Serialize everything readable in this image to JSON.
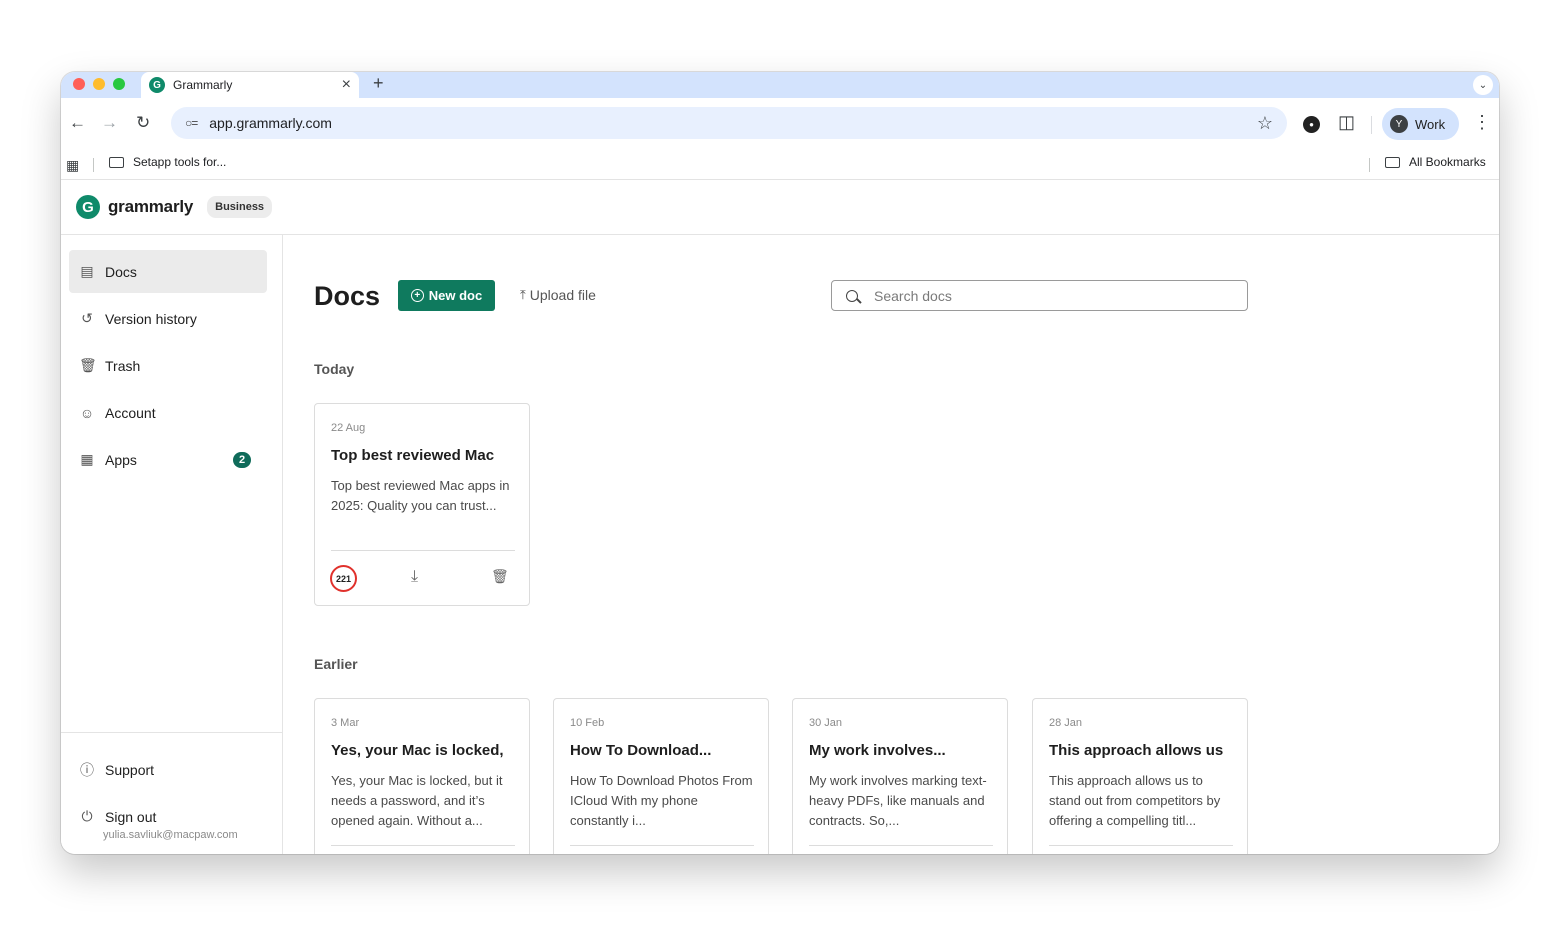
{
  "browser": {
    "tab_title": "Grammarly",
    "tab_close": "×",
    "new_tab": "+",
    "url": "app.grammarly.com",
    "profile_initial": "Y",
    "profile_label": "Work",
    "bookmark_folder": "Setapp tools for...",
    "all_bookmarks": "All Bookmarks"
  },
  "app": {
    "brand": "grammarly",
    "logo_letter": "G",
    "plan_badge": "Business"
  },
  "sidebar": {
    "items": [
      {
        "label": "Docs",
        "icon": "document-icon"
      },
      {
        "label": "Version history",
        "icon": "history-icon"
      },
      {
        "label": "Trash",
        "icon": "trash-icon"
      },
      {
        "label": "Account",
        "icon": "account-icon"
      },
      {
        "label": "Apps",
        "icon": "apps-icon",
        "badge": "2"
      }
    ],
    "support_label": "Support",
    "signout_label": "Sign out",
    "user_email": "yulia.savliuk@macpaw.com"
  },
  "main": {
    "title": "Docs",
    "new_doc_label": "New doc",
    "upload_label": "Upload file",
    "search_placeholder": "Search docs",
    "today_label": "Today",
    "earlier_label": "Earlier",
    "today_docs": [
      {
        "date": "22 Aug",
        "title": "Top best reviewed Mac",
        "snippet": "Top best reviewed Mac apps in 2025: Quality you can trust...",
        "score": "221"
      }
    ],
    "earlier_docs": [
      {
        "date": "3 Mar",
        "title": "Yes, your Mac is locked,",
        "snippet": "Yes, your Mac is locked, but it needs a password, and it’s opened again. Without a..."
      },
      {
        "date": "10 Feb",
        "title": "How To Download...",
        "snippet": "How To Download Photos From ICloud With my phone constantly i..."
      },
      {
        "date": "30 Jan",
        "title": "My work involves...",
        "snippet": "My work involves marking text-heavy PDFs, like manuals and contracts. So,..."
      },
      {
        "date": "28 Jan",
        "title": "This approach allows us",
        "snippet": "This approach allows us to stand out from competitors by offering a compelling titl..."
      }
    ]
  },
  "colors": {
    "brand_green": "#0f7a5e",
    "score_red": "#e0312c",
    "tab_strip": "#d3e3fd"
  }
}
